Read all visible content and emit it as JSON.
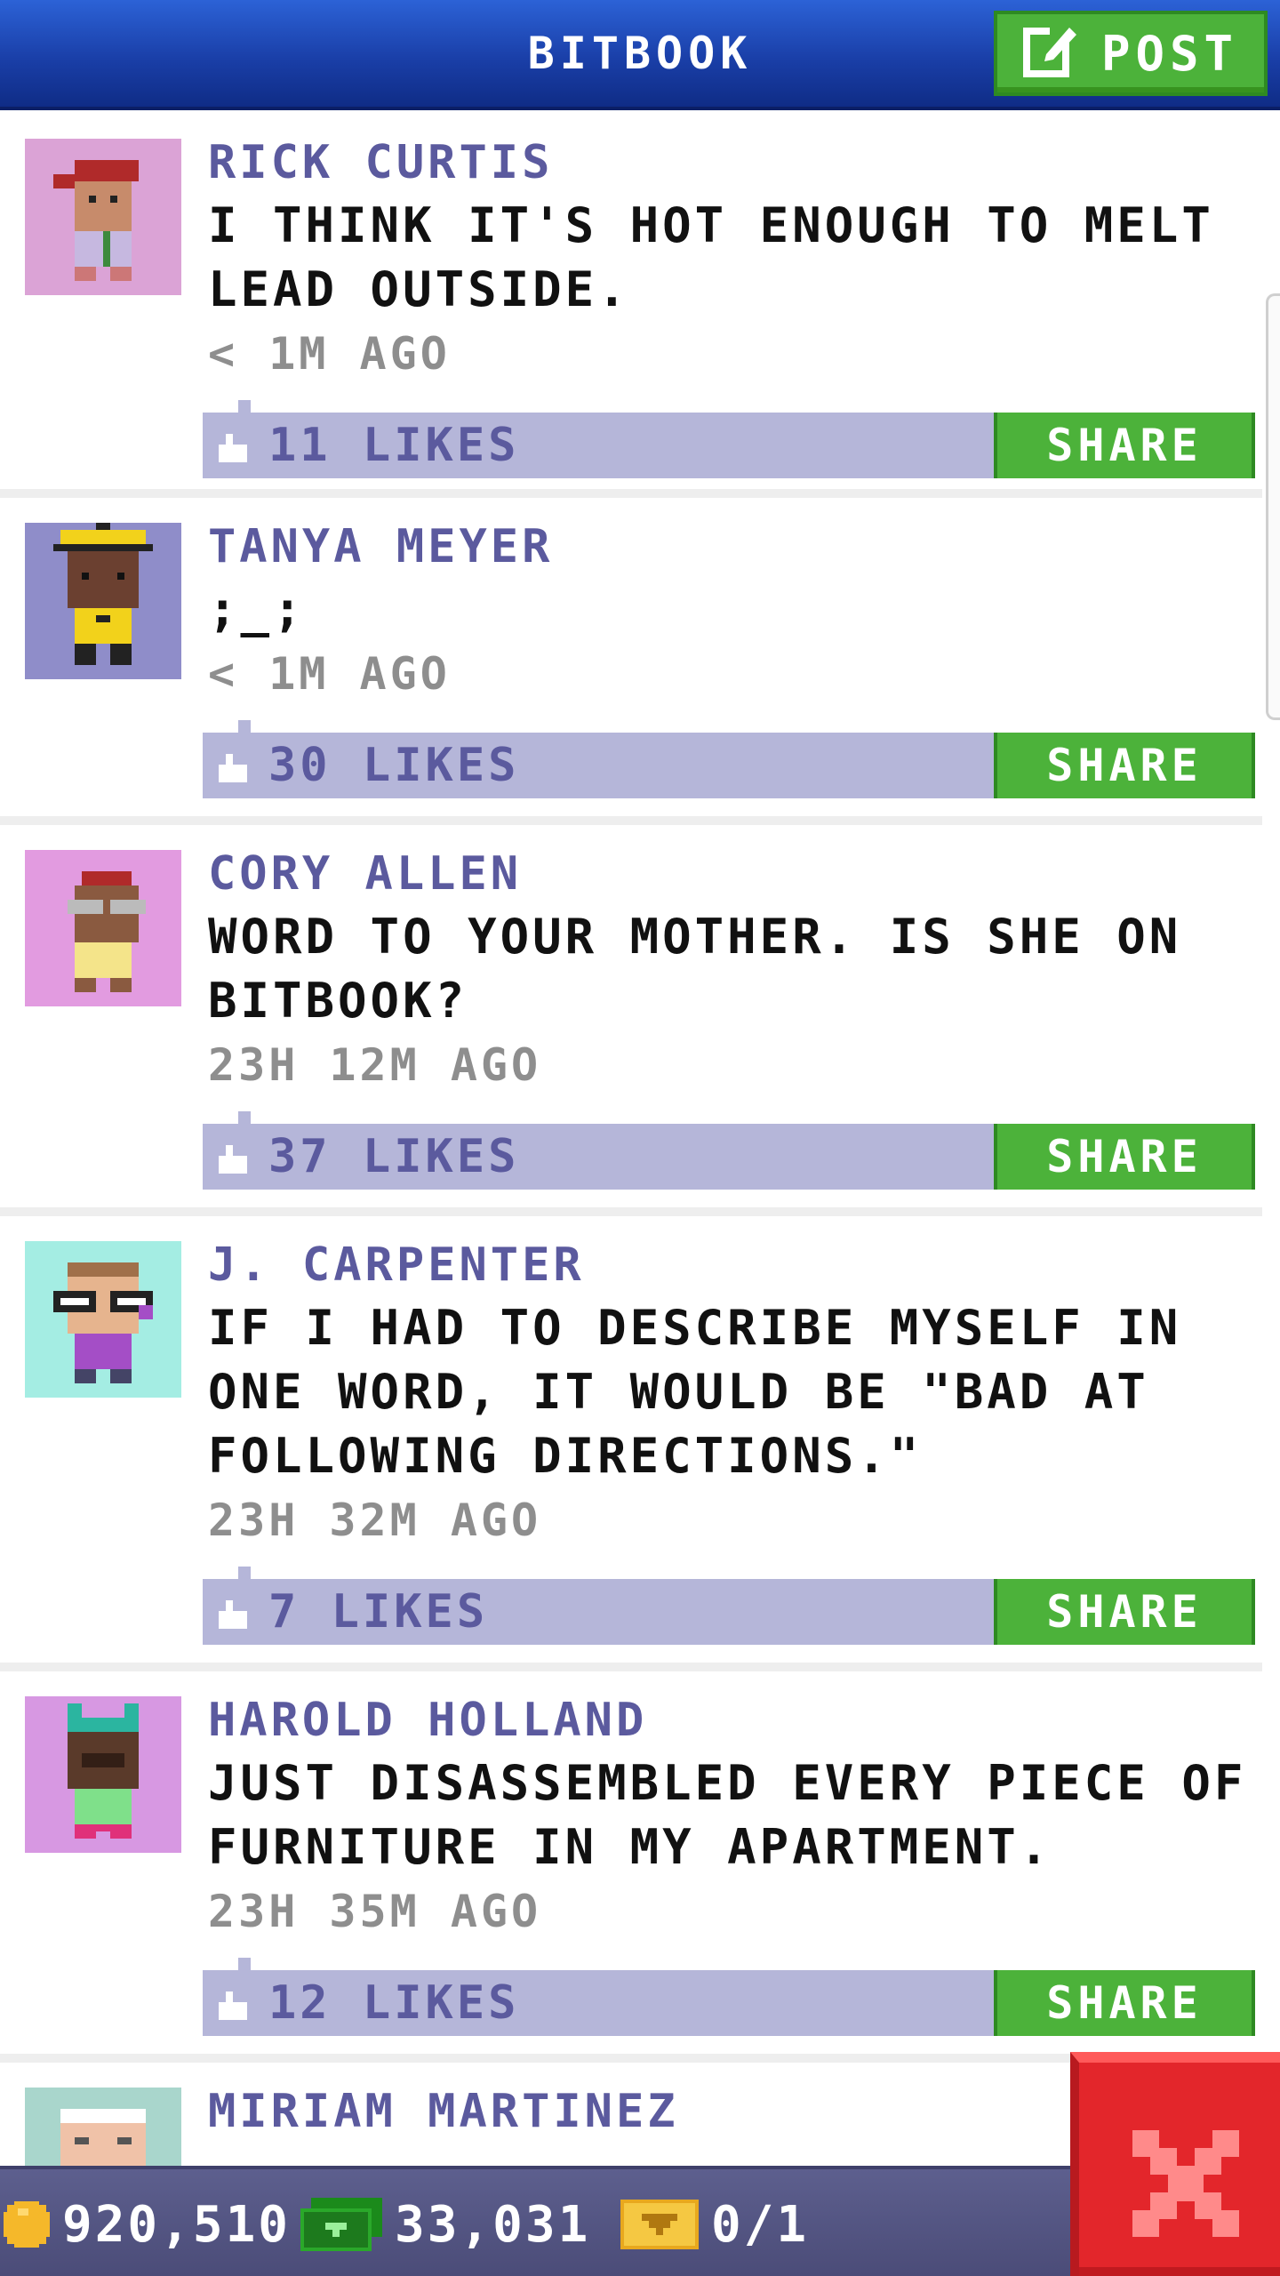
{
  "header": {
    "title": "BITBOOK",
    "post_label": "POST"
  },
  "feed": {
    "posts": [
      {
        "author": "RICK CURTIS",
        "message": "I THINK IT'S HOT ENOUGH TO MELT LEAD OUTSIDE.",
        "time": "< 1M AGO",
        "likes": "11 LIKES",
        "share_label": "SHARE",
        "avatar_bg": "#dba3d6"
      },
      {
        "author": "TANYA MEYER",
        "message": ";_;",
        "time": "< 1M AGO",
        "likes": "30 LIKES",
        "share_label": "SHARE",
        "avatar_bg": "#8f8dc9"
      },
      {
        "author": "CORY ALLEN",
        "message": "WORD TO YOUR MOTHER. IS SHE ON BITBOOK?",
        "time": "23H 12M AGO",
        "likes": "37 LIKES",
        "share_label": "SHARE",
        "avatar_bg": "#e29be0"
      },
      {
        "author": "J. CARPENTER",
        "message": "IF I HAD TO DESCRIBE MYSELF IN ONE WORD, IT WOULD BE \"BAD AT FOLLOWING DIRECTIONS.\"",
        "time": "23H 32M AGO",
        "likes": "7 LIKES",
        "share_label": "SHARE",
        "avatar_bg": "#a4ede3"
      },
      {
        "author": "HAROLD HOLLAND",
        "message": "JUST DISASSEMBLED EVERY PIECE OF FURNITURE IN MY APARTMENT.",
        "time": "23H 35M AGO",
        "likes": "12 LIKES",
        "share_label": "SHARE",
        "avatar_bg": "#d798e2"
      },
      {
        "author": "MIRIAM MARTINEZ",
        "avatar_bg": "#a9d6cc"
      }
    ]
  },
  "bottom_bar": {
    "coins": "920,510",
    "bux": "33,031",
    "tickets": "0/1"
  },
  "icons": {
    "post": "edit-icon",
    "like": "thumbs-up-icon",
    "close": "close-icon",
    "coin": "coin-icon",
    "bux": "bux-icon",
    "ticket": "vip-ticket-icon"
  },
  "colors": {
    "header": "#1a3fa8",
    "accent_green": "#4cb23a",
    "like_bar": "#b5b6d9",
    "author_text": "#5b5a9e",
    "close_red": "#e3262b",
    "bottom_bar": "#4b4c78"
  }
}
